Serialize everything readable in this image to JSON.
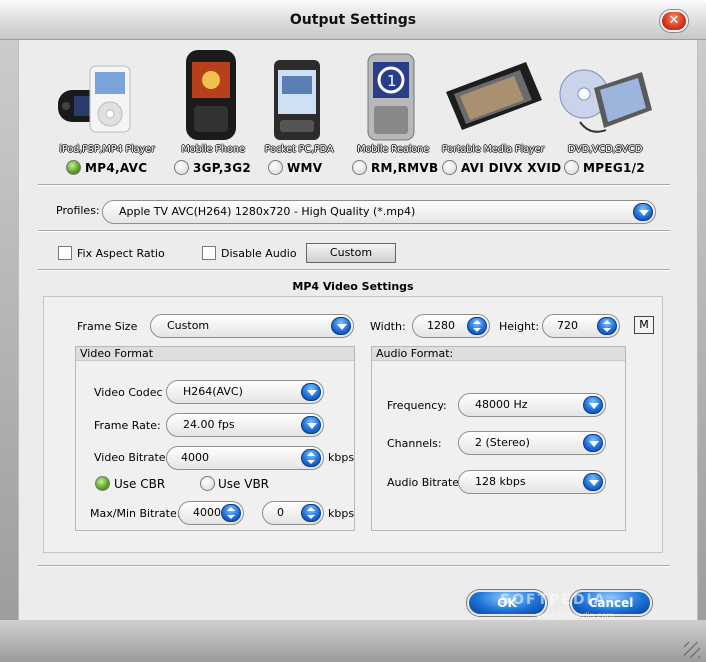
{
  "window": {
    "title": "Output Settings"
  },
  "devices": [
    {
      "label": "iPod,PSP,MP4 Player",
      "format": "MP4,AVC",
      "selected": true,
      "icon": "ipod-psp-icon"
    },
    {
      "label": "Mobile Phone",
      "format": "3GP,3G2",
      "selected": false,
      "icon": "mobile-phone-icon"
    },
    {
      "label": "Pocket PC,PDA",
      "format": "WMV",
      "selected": false,
      "icon": "pda-icon"
    },
    {
      "label": "Mobile Realone",
      "format": "RM,RMVB",
      "selected": false,
      "icon": "realone-phone-icon"
    },
    {
      "label": "Portable Media Player",
      "format": "AVI DIVX XVID",
      "selected": false,
      "icon": "media-player-icon"
    },
    {
      "label": "DVD,VCD,SVCD",
      "format": "MPEG1/2",
      "selected": false,
      "icon": "dvd-disc-icon"
    }
  ],
  "profiles": {
    "label": "Profiles:",
    "value": "Apple TV AVC(H264) 1280x720 - High Quality (*.mp4)"
  },
  "options": {
    "fix_aspect": "Fix Aspect Ratio",
    "disable_audio": "Disable Audio",
    "custom": "Custom"
  },
  "settings": {
    "title": "MP4 Video Settings",
    "frame_size_label": "Frame Size",
    "frame_size": "Custom",
    "width_label": "Width:",
    "width": "1280",
    "height_label": "Height:",
    "height": "720",
    "m_button": "M"
  },
  "video": {
    "title": "Video Format",
    "codec_label": "Video Codec",
    "codec": "H264(AVC)",
    "framerate_label": "Frame Rate:",
    "framerate": "24.00 fps",
    "bitrate_label": "Video Bitrate:",
    "bitrate": "4000",
    "bitrate_unit": "kbps",
    "cbr": "Use CBR",
    "vbr": "Use VBR",
    "maxmin_label": "Max/Min Bitrate:",
    "max": "4000",
    "min": "0",
    "maxmin_unit": "kbps"
  },
  "audio": {
    "title": "Audio Format:",
    "frequency_label": "Frequency:",
    "frequency": "48000 Hz",
    "channels_label": "Channels:",
    "channels": "2 (Stereo)",
    "bitrate_label": "Audio Bitrate:",
    "bitrate": "128 kbps"
  },
  "buttons": {
    "ok": "OK",
    "cancel": "Cancel"
  },
  "watermark": {
    "text": "SOFTPEDIA",
    "url": "www.softpedia.com"
  }
}
